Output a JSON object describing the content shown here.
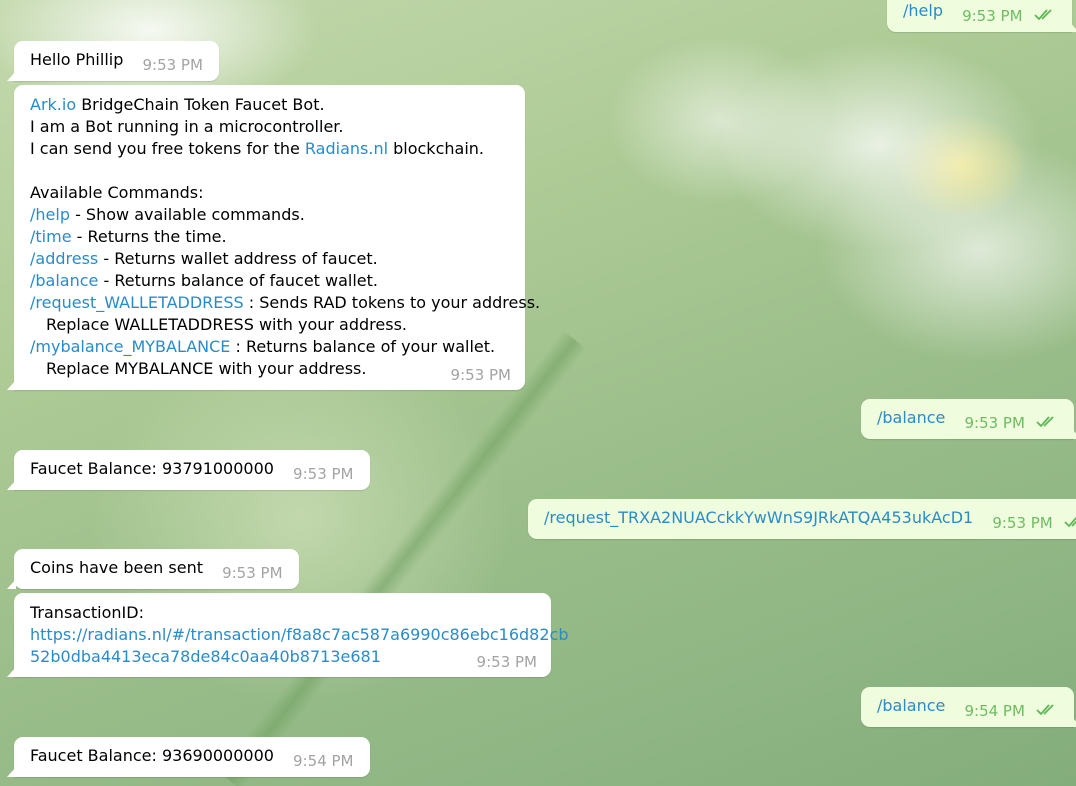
{
  "messages": {
    "m1": {
      "text": "/help",
      "time": "9:53 PM"
    },
    "m2": {
      "text": "Hello Phillip",
      "time": "9:53 PM"
    },
    "m3": {
      "intro_link": "Ark.io",
      "intro_rest": " BridgeChain Token Faucet Bot.",
      "line2": "I am a Bot running in a microcontroller.",
      "line3_a": "I can send you free tokens for the ",
      "line3_link": "Radians.nl",
      "line3_b": " blockchain",
      "line3_end": ".",
      "commands_header": "Available Commands:",
      "commands": [
        {
          "cmd": "/help",
          "desc": " - Show available commands."
        },
        {
          "cmd": "/time",
          "desc": " - Returns the time."
        },
        {
          "cmd": "/address",
          "desc": " - Returns wallet address of faucet."
        },
        {
          "cmd": "/balance",
          "desc": " - Returns balance of faucet wallet."
        },
        {
          "cmd": "/request_WALLETADDRESS",
          "desc": " : Sends RAD tokens to your address."
        }
      ],
      "request_note": "Replace WALLETADDRESS with your address.",
      "mybalance_cmd": "/mybalance_MYBALANCE",
      "mybalance_desc": " : Returns balance of your wallet.",
      "mybalance_note": "Replace MYBALANCE with your address.",
      "time": "9:53 PM"
    },
    "m4": {
      "text": "/balance",
      "time": "9:53 PM"
    },
    "m5": {
      "text": "Faucet Balance: 93791000000",
      "time": "9:53 PM"
    },
    "m6": {
      "text": "/request_TRXA2NUACckkYwWnS9JRkATQA453ukAcD1",
      "time": "9:53 PM"
    },
    "m7": {
      "text": "Coins have been sent",
      "time": "9:53 PM"
    },
    "m8": {
      "label": "TransactionID:",
      "link_line1": "https://radians.nl/#/transaction/f8a8c7ac587a6990c86ebc16d82cb",
      "link_line2": "52b0dba4413eca78de84c0aa40b8713e681",
      "time": "9:53 PM"
    },
    "m9": {
      "text": "/balance",
      "time": "9:54 PM"
    },
    "m10": {
      "text": "Faucet Balance: 93690000000",
      "time": "9:54 PM"
    }
  },
  "colors": {
    "link": "#2a8bc8",
    "outgoing_bg": "#effdde",
    "incoming_bg": "#ffffff",
    "outgoing_time": "#6dbd60",
    "incoming_time": "#a3a3a3"
  },
  "icons": {
    "read_receipt": "double-check-icon"
  }
}
